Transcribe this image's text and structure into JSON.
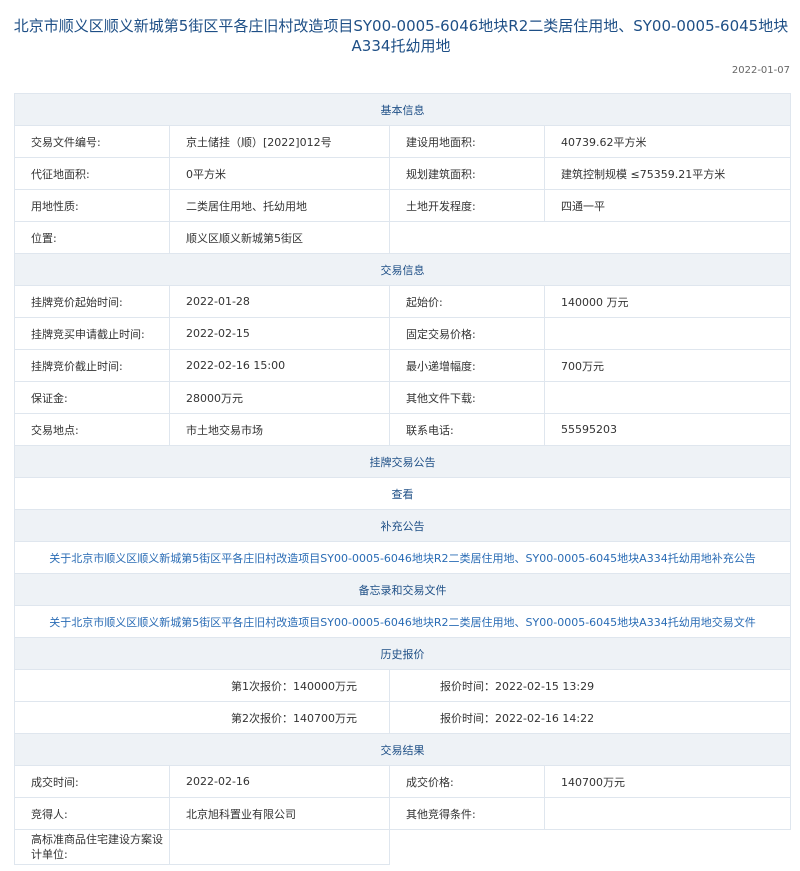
{
  "header": {
    "title": "北京市顺义区顺义新城第5街区平各庄旧村改造项目SY00-0005-6046地块R2二类居住用地、SY00-0005-6045地块A334托幼用地",
    "date": "2022-01-07"
  },
  "basic": {
    "section_title": "基本信息",
    "rows": [
      {
        "l1": "交易文件编号:",
        "v1": "京土储挂（顺）[2022]012号",
        "l2": "建设用地面积:",
        "v2": "40739.62平方米"
      },
      {
        "l1": "代征地面积:",
        "v1": "0平方米",
        "l2": "规划建筑面积:",
        "v2": "建筑控制规模 ≤75359.21平方米"
      },
      {
        "l1": "用地性质:",
        "v1": "二类居住用地、托幼用地",
        "l2": "土地开发程度:",
        "v2": "四通一平"
      }
    ],
    "location_label": "位置:",
    "location_value": "顺义区顺义新城第5街区"
  },
  "trade": {
    "section_title": "交易信息",
    "rows": [
      {
        "l1": "挂牌竞价起始时间:",
        "v1": "2022-01-28",
        "l2": "起始价:",
        "v2": "140000 万元"
      },
      {
        "l1": "挂牌竞买申请截止时间:",
        "v1": "2022-02-15",
        "l2": "固定交易价格:",
        "v2": ""
      },
      {
        "l1": "挂牌竞价截止时间:",
        "v1": "2022-02-16 15:00",
        "l2": "最小递增幅度:",
        "v2": "700万元"
      },
      {
        "l1": "保证金:",
        "v1": "28000万元",
        "l2": "其他文件下载:",
        "v2": ""
      },
      {
        "l1": "交易地点:",
        "v1": "市土地交易市场",
        "l2": "联系电话:",
        "v2": "55595203"
      }
    ]
  },
  "listing": {
    "section_title": "挂牌交易公告",
    "view_link": "查看"
  },
  "supplement": {
    "section_title": "补充公告",
    "link": "关于北京市顺义区顺义新城第5街区平各庄旧村改造项目SY00-0005-6046地块R2二类居住用地、SY00-0005-6045地块A334托幼用地补充公告"
  },
  "memo": {
    "section_title": "备忘录和交易文件",
    "link": "关于北京市顺义区顺义新城第5街区平各庄旧村改造项目SY00-0005-6046地块R2二类居住用地、SY00-0005-6045地块A334托幼用地交易文件"
  },
  "history": {
    "section_title": "历史报价",
    "rows": [
      {
        "bid": "第1次报价：140000万元",
        "time": "报价时间：2022-02-15 13:29"
      },
      {
        "bid": "第2次报价：140700万元",
        "time": "报价时间：2022-02-16 14:22"
      }
    ]
  },
  "result": {
    "section_title": "交易结果",
    "rows": [
      {
        "l1": "成交时间:",
        "v1": "2022-02-16",
        "l2": "成交价格:",
        "v2": "140700万元"
      },
      {
        "l1": "竞得人:",
        "v1": "北京旭科置业有限公司",
        "l2": "其他竞得条件:",
        "v2": ""
      }
    ],
    "design_label": "高标准商品住宅建设方案设计单位:",
    "design_value": ""
  },
  "colors": {
    "title": "#1e4f86",
    "link": "#2a6cb5",
    "section_bg": "#eef2f6",
    "border": "#dfe6ee"
  }
}
